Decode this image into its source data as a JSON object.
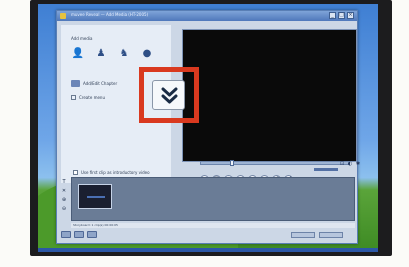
{
  "window": {
    "title": "muvee Reveal — Add Media (HT-2005)",
    "controls": [
      "_",
      "□",
      "×"
    ]
  },
  "left_panel": {
    "add_media_label": "Add media",
    "media_buttons": [
      {
        "name": "add-photos-icon",
        "glyph": "👤"
      },
      {
        "name": "add-video-icon",
        "glyph": "♟"
      },
      {
        "name": "add-music-icon",
        "glyph": "♞"
      },
      {
        "name": "add-web-icon",
        "glyph": "●"
      }
    ],
    "chapter_label": "Add/Edit Chapter",
    "create_menu_label": "Create menu",
    "create_menu_checked": true
  },
  "expand_button": {
    "icon": "double-chevron-down-icon"
  },
  "player": {
    "controls": [
      "▶",
      "■",
      "◀◀",
      "◀",
      "▶",
      "▶▶",
      "↺",
      "▶|"
    ],
    "seek_position": 0.2,
    "volume": 0.8
  },
  "intro_option_label": "Use first clip as introductory video",
  "timeline_tools": [
    "T",
    "✕",
    "⊕",
    "⊖"
  ],
  "status_text": "Storyboard: 1 clip(s) 00:00:05",
  "colors": {
    "highlight": "#d9391f",
    "title_bar": "#4f78bb",
    "preview": "#0a0a0a"
  }
}
